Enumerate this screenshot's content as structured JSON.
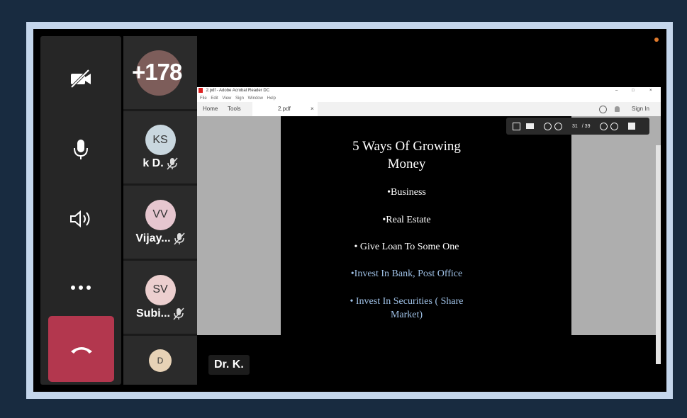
{
  "controls": {
    "items": [
      {
        "icon": "video-off-icon"
      },
      {
        "icon": "microphone-icon"
      },
      {
        "icon": "speaker-icon"
      },
      {
        "icon": "more-options-icon"
      },
      {
        "icon": "end-call-icon"
      }
    ],
    "hangup_color": "#b3374e"
  },
  "participants": {
    "more_count": "+178",
    "list": [
      {
        "initials": "KS",
        "name": "k D.",
        "avatar_color": "#c9d7df",
        "muted": true
      },
      {
        "initials": "VV",
        "name": "Vijay...",
        "avatar_color": "#e6c6cf",
        "muted": true
      },
      {
        "initials": "SV",
        "name": "Subi...",
        "avatar_color": "#eccfcf",
        "muted": true
      },
      {
        "initials": "D",
        "name": "",
        "avatar_color": "#e7d2b6",
        "muted": false
      }
    ]
  },
  "pdf": {
    "window_title": "2.pdf - Adobe Acrobat Reader DC",
    "menu": [
      "File",
      "Edit",
      "View",
      "Sign",
      "Window",
      "Help"
    ],
    "tabs": {
      "home": "Home",
      "tools": "Tools",
      "doc": "2.pdf",
      "close": "×"
    },
    "sign_in": "Sign In",
    "page_current": "31",
    "page_total": "/ 39",
    "slide": {
      "title_line1": "5 Ways Of Growing",
      "title_line2": "Money",
      "bullets": [
        {
          "text": "•Business",
          "color": "#ffffff"
        },
        {
          "text": "•Real Estate",
          "color": "#ffffff"
        },
        {
          "text": "• Give Loan To Some One",
          "color": "#ffffff"
        },
        {
          "text": "•Invest In Bank, Post Office",
          "color": "#9fc1e6"
        },
        {
          "text": "• Invest In Securities ( Share",
          "color": "#9fc1e6"
        },
        {
          "text": "Market)",
          "color": "#9fc1e6"
        }
      ]
    }
  },
  "presenter_name": "Dr. K.",
  "window_controls": {
    "minimize": "–",
    "maximize": "□",
    "close": "×"
  }
}
